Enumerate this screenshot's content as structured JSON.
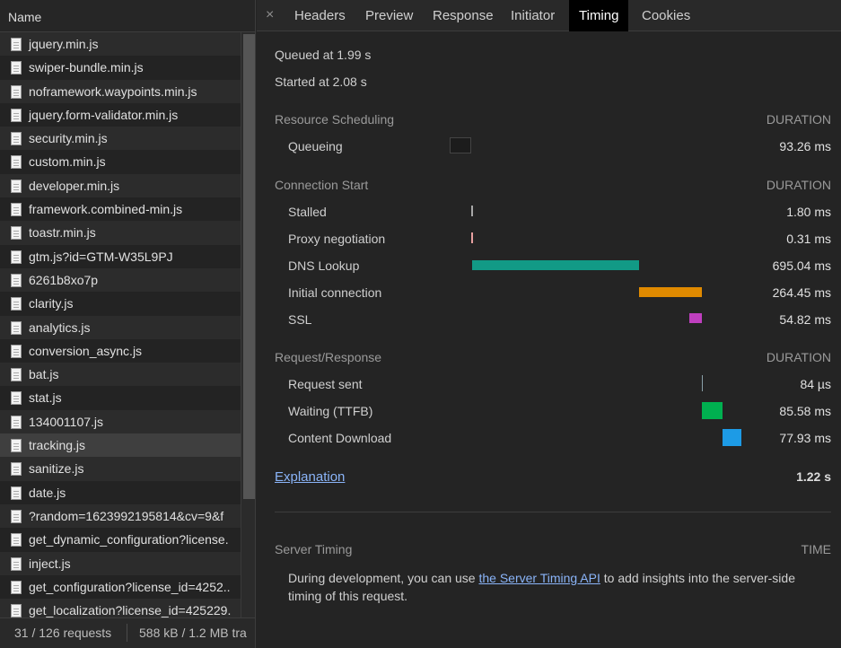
{
  "file_list": {
    "header": "Name",
    "items": [
      "jquery.min.js",
      "swiper-bundle.min.js",
      "noframework.waypoints.min.js",
      "jquery.form-validator.min.js",
      "security.min.js",
      "custom.min.js",
      "developer.min.js",
      "framework.combined-min.js",
      "toastr.min.js",
      "gtm.js?id=GTM-W35L9PJ",
      "6261b8xo7p",
      "clarity.js",
      "analytics.js",
      "conversion_async.js",
      "bat.js",
      "stat.js",
      "134001107.js",
      "tracking.js",
      "sanitize.js",
      "date.js",
      "?random=1623992195814&cv=9&f",
      "get_dynamic_configuration?license.",
      "inject.js",
      "get_configuration?license_id=4252..",
      "get_localization?license_id=425229."
    ],
    "selected": "tracking.js"
  },
  "status_bar": {
    "requests": "31 / 126 requests",
    "transferred": "588 kB / 1.2 MB tra"
  },
  "tabs": {
    "close_glyph": "×",
    "items": [
      "Headers",
      "Preview",
      "Response",
      "Initiator",
      "Timing",
      "Cookies"
    ],
    "active": "Timing"
  },
  "timing": {
    "queued_at": "Queued at 1.99 s",
    "started_at": "Started at 2.08 s",
    "duration_label": "DURATION",
    "sections": [
      {
        "title": "Resource Scheduling",
        "rows": [
          {
            "label": "Queueing",
            "value": "93.26 ms"
          }
        ]
      },
      {
        "title": "Connection Start",
        "rows": [
          {
            "label": "Stalled",
            "value": "1.80 ms"
          },
          {
            "label": "Proxy negotiation",
            "value": "0.31 ms"
          },
          {
            "label": "DNS Lookup",
            "value": "695.04 ms"
          },
          {
            "label": "Initial connection",
            "value": "264.45 ms"
          },
          {
            "label": "SSL",
            "value": "54.82 ms"
          }
        ]
      },
      {
        "title": "Request/Response",
        "rows": [
          {
            "label": "Request sent",
            "value": "84 µs"
          },
          {
            "label": "Waiting (TTFB)",
            "value": "85.58 ms"
          },
          {
            "label": "Content Download",
            "value": "77.93 ms"
          }
        ]
      }
    ],
    "explanation_link": "Explanation",
    "total": "1.22 s"
  },
  "bar_colors": {
    "stalled": "#a8a8a8",
    "proxy": "#e8a0a0",
    "dns": "#129a86",
    "connection": "#e08a00",
    "ssl": "#bf3fbf",
    "request_sent": "#8aa0a8",
    "waiting": "#00b050",
    "download": "#1d9be6"
  },
  "server_timing": {
    "title": "Server Timing",
    "time_label": "TIME",
    "text_before": "During development, you can use ",
    "link": "the Server Timing API",
    "text_after": " to add insights into the server-side",
    "text_line2": "timing of this request."
  }
}
